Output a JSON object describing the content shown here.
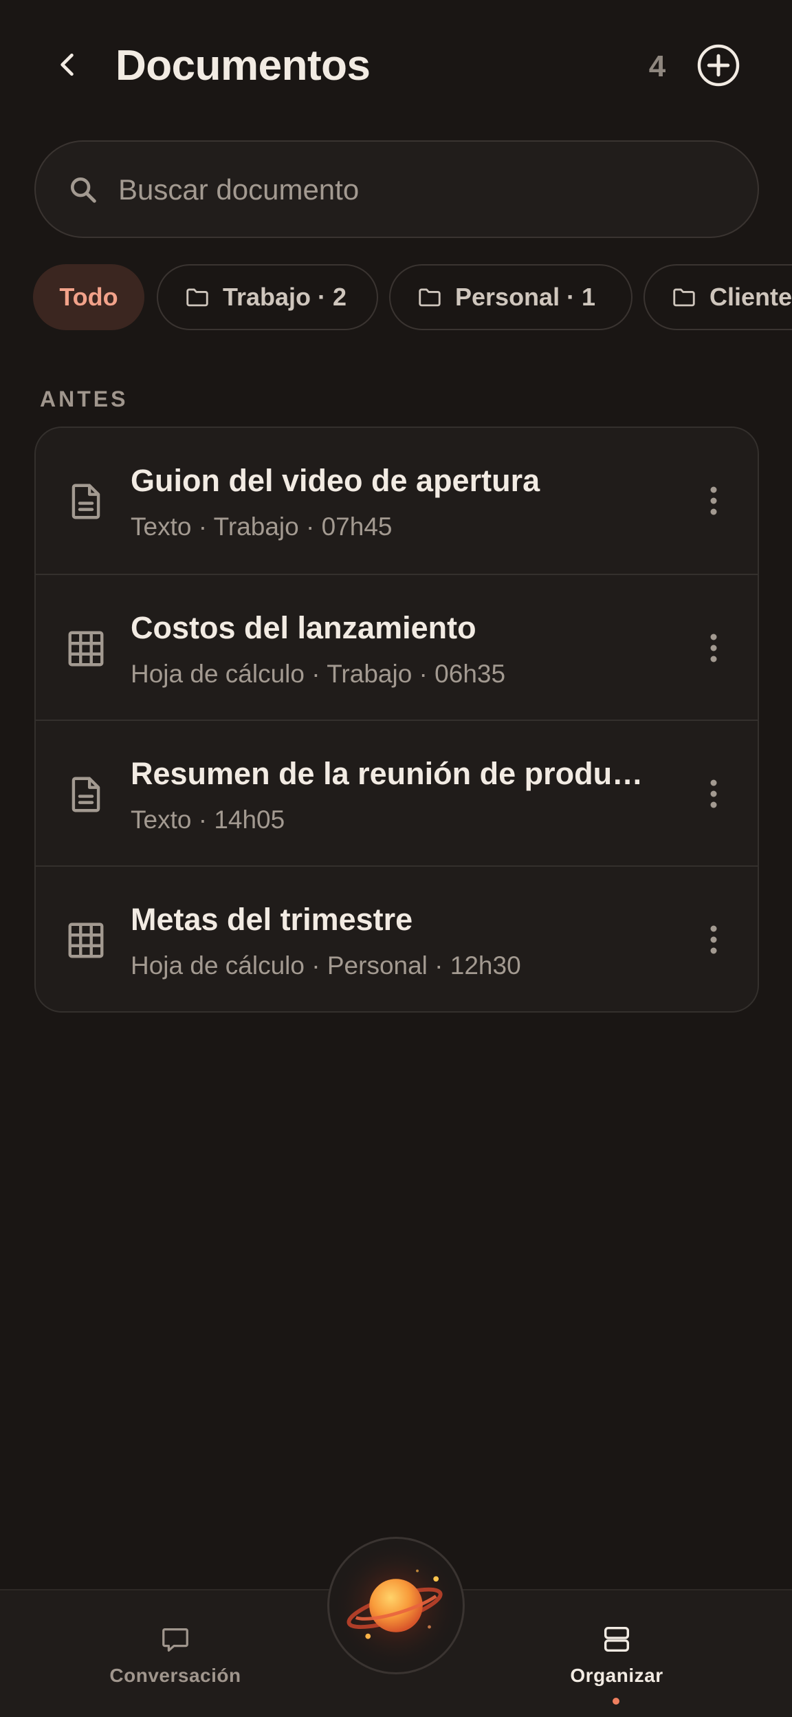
{
  "header": {
    "title": "Documentos",
    "count": "4"
  },
  "search": {
    "placeholder": "Buscar documento",
    "value": ""
  },
  "filters": [
    {
      "label": "Todo",
      "active": true
    },
    {
      "label": "Trabajo · 2",
      "active": false
    },
    {
      "label": "Personal · 1",
      "active": false
    },
    {
      "label": "Clientes",
      "active": false
    }
  ],
  "section": {
    "label": "ANTES"
  },
  "documents": [
    {
      "title": "Guion del video de apertura",
      "meta": "Texto · Trabajo · 07h45",
      "icon": "document-icon"
    },
    {
      "title": "Costos del lanzamiento",
      "meta": "Hoja de cálculo · Trabajo · 06h35",
      "icon": "spreadsheet-icon"
    },
    {
      "title": "Resumen de la reunión de produ…",
      "meta": "Texto · 14h05",
      "icon": "document-icon"
    },
    {
      "title": "Metas del trimestre",
      "meta": "Hoja de cálculo · Personal · 12h30",
      "icon": "spreadsheet-icon"
    }
  ],
  "nav": {
    "conversation_label": "Conversación",
    "organize_label": "Organizar",
    "active": "organize"
  },
  "colors": {
    "background": "#1a1614",
    "surface": "#201c1a",
    "accent": "#ef7f5f",
    "chip_active_bg": "#3b2620",
    "chip_active_text": "#f2a28a"
  }
}
